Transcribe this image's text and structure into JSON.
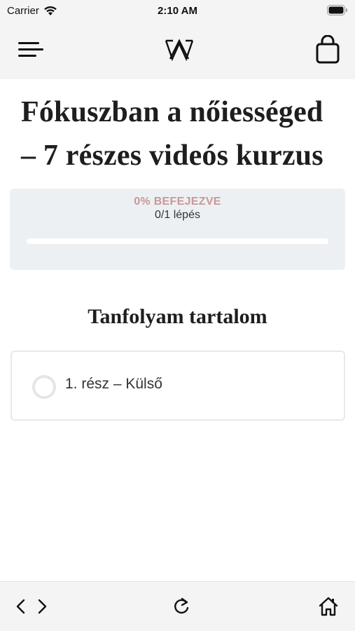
{
  "status_bar": {
    "carrier": "Carrier",
    "time": "2:10 AM"
  },
  "header": {
    "menu_icon": "hamburger-menu-icon",
    "logo": "WA",
    "cart_icon": "shopping-bag-icon"
  },
  "course": {
    "title": "Fókuszban a nőiességed – 7 részes videós kurzus"
  },
  "progress": {
    "percent_label": "0% BEFEJEZVE",
    "steps_label": "0/1 lépés",
    "fraction": 0,
    "accent_color": "#c9979b"
  },
  "section": {
    "heading": "Tanfolyam tartalom"
  },
  "lessons": [
    {
      "label": "1. rész – Külső",
      "completed": false
    }
  ],
  "bottom_bar": {
    "back_icon": "chevron-left-icon",
    "forward_icon": "chevron-right-icon",
    "reload_icon": "reload-icon",
    "home_icon": "home-icon"
  }
}
